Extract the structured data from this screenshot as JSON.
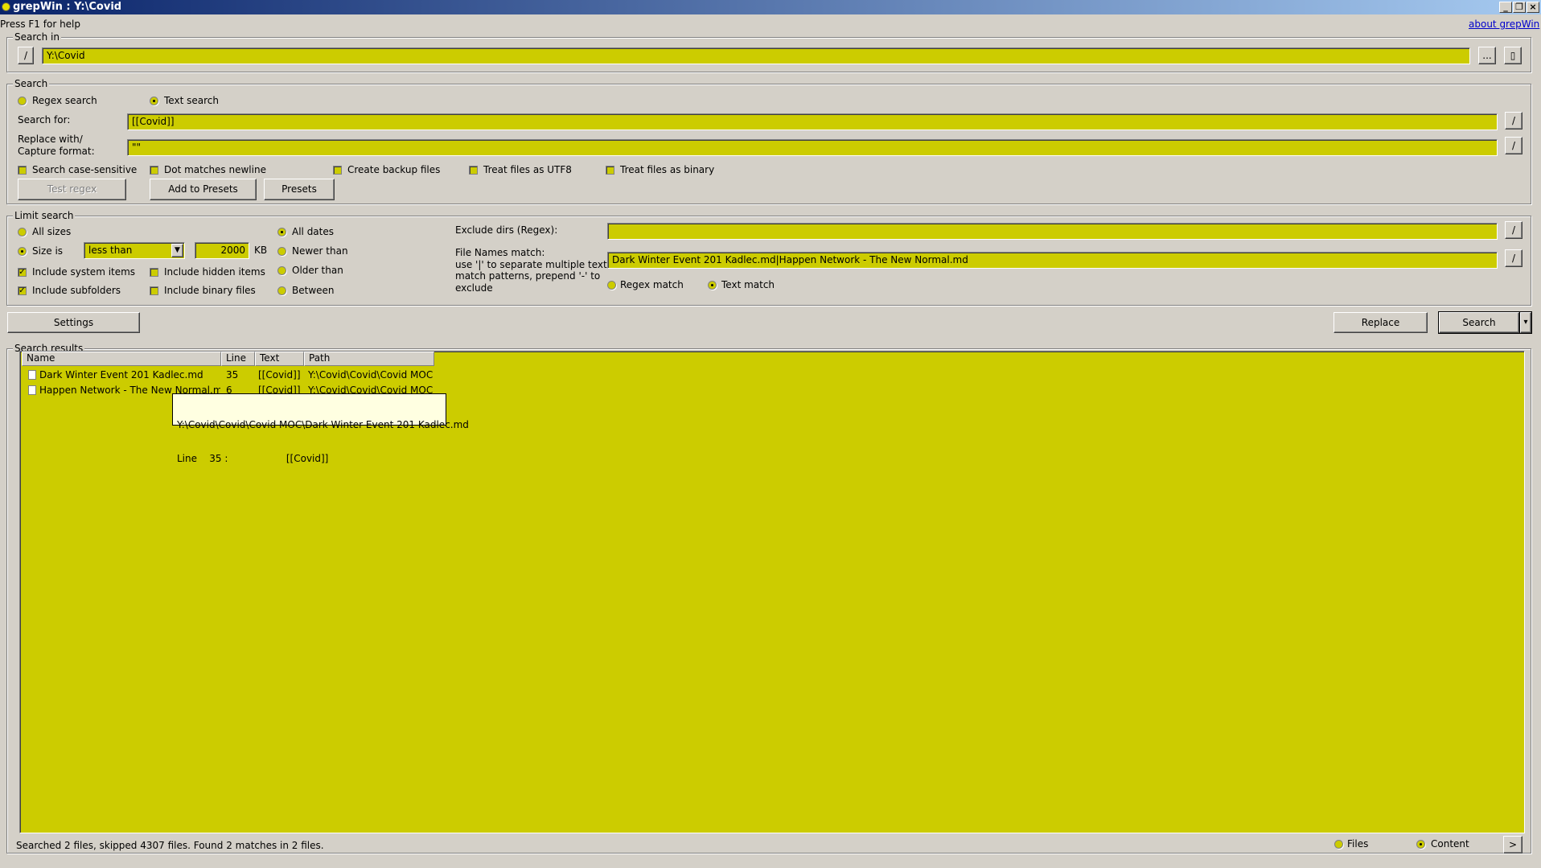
{
  "window": {
    "title": "grepWin : Y:\\Covid",
    "help_hint": "Press F1 for help",
    "about_link": "about grepWin"
  },
  "search_in": {
    "group_label": "Search in",
    "slash": "/",
    "path": "Y:\\Covid",
    "browse": "...",
    "doc_btn": "▯"
  },
  "search": {
    "group_label": "Search",
    "regex_label": "Regex search",
    "text_label": "Text search",
    "selected_mode": "text",
    "search_for_label": "Search for:",
    "search_for_value": "[[Covid]]",
    "replace_label_1": "Replace with/",
    "replace_label_2": "Capture format:",
    "replace_value": "\"\"",
    "slash": "/",
    "options": [
      {
        "label": "Search case-sensitive",
        "checked": false
      },
      {
        "label": "Dot matches newline",
        "checked": false
      },
      {
        "label": "Create backup files",
        "checked": false
      },
      {
        "label": "Treat files as UTF8",
        "checked": false
      },
      {
        "label": "Treat files as binary",
        "checked": false
      }
    ],
    "test_regex": "Test regex",
    "add_presets": "Add to Presets",
    "presets": "Presets"
  },
  "limit": {
    "group_label": "Limit search",
    "all_sizes": "All sizes",
    "size_is": "Size is",
    "size_op": "less than",
    "size_value": "2000",
    "size_unit": "KB",
    "include_system": "Include system items",
    "include_hidden": "Include hidden items",
    "include_subfolders": "Include subfolders",
    "include_binary": "Include binary files",
    "all_dates": "All dates",
    "newer_than": "Newer than",
    "older_than": "Older than",
    "between": "Between",
    "exclude_dirs_label": "Exclude dirs (Regex):",
    "exclude_dirs_value": "",
    "file_names_label": "File Names match:",
    "file_names_help_1": "use '|' to separate multiple text",
    "file_names_help_2": "match patterns, prepend '-' to",
    "file_names_help_3": "exclude",
    "file_names_value": "Dark Winter Event 201 Kadlec.md|Happen Network - The New Normal.md",
    "regex_match": "Regex match",
    "text_match": "Text match",
    "slash": "/"
  },
  "actions": {
    "settings": "Settings",
    "replace": "Replace",
    "search": "Search",
    "dropdown": "▾"
  },
  "results": {
    "group_label": "Search results",
    "columns": [
      "Name",
      "Line",
      "Text",
      "Path"
    ],
    "rows": [
      {
        "name": "Dark Winter Event 201 Kadlec.md",
        "line": "35",
        "text": "[[Covid]]",
        "path": "Y:\\Covid\\Covid\\Covid MOC"
      },
      {
        "name": "Happen Network - The New Normal.md",
        "line": "6",
        "text": "[[Covid]]",
        "path": "Y:\\Covid\\Covid\\Covid MOC"
      }
    ],
    "tooltip_path": "Y:\\Covid\\Covid\\Covid MOC\\Dark Winter Event 201 Kadlec.md",
    "tooltip_line": "Line    35 :                   [[Covid]]"
  },
  "status": {
    "text": "Searched 2 files, skipped 4307 files. Found 2 matches in 2 files.",
    "files": "Files",
    "content": "Content",
    "next": ">"
  }
}
